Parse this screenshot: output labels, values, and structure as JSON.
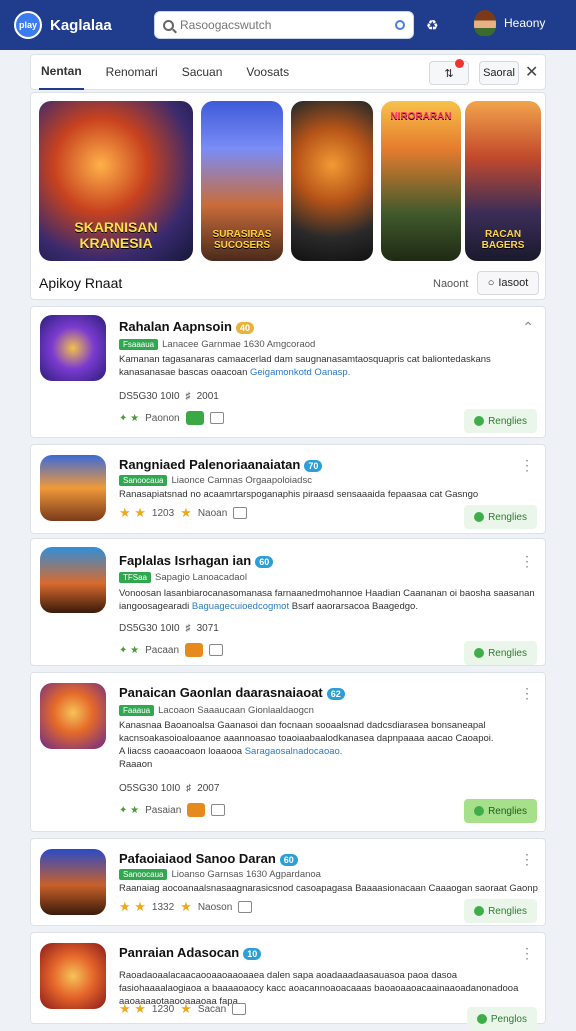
{
  "header": {
    "logo": "play",
    "title": "Kaglalaa",
    "search_placeholder": "Rasoogacswutch",
    "user_name": "Heaony"
  },
  "tabs": [
    {
      "label": "Nentan",
      "active": true
    },
    {
      "label": "Renomari"
    },
    {
      "label": "Sacuan"
    },
    {
      "label": "Voosats"
    }
  ],
  "toolbar": {
    "filter_label": "⇅",
    "sort_label": "Saoral"
  },
  "banner": {
    "heroes": [
      {
        "title": "SKARNISAN KRANESIA"
      },
      {
        "title": "SURASIRAS SUCOSERS"
      },
      {
        "title": ""
      },
      {
        "title": "NIRORARAN"
      },
      {
        "title": "RACAN BAGERS"
      }
    ],
    "featured_label": "Apikoy Rnaat",
    "more_link": "Naoont",
    "view_button": "Iasoot"
  },
  "apps": [
    {
      "name": "Rahalan Aapnsoin",
      "verify": "40",
      "meta": "Lanacee Garnmae 1630 Amgcoraod",
      "desc": "Kamanan tagasanaras camaacerlad dam saugnanasamtaosquapris cat baliontedaskans kanasanasae bascas oaacoan",
      "desc_link": "Geigamonkotd Oanasp.",
      "stats": "DS5G30 10I0",
      "stats2": "2001",
      "bottom": "Paonon",
      "install": "Renglies"
    },
    {
      "name": "Rangniaed Palenoriaanaiatan",
      "verify": "70",
      "meta": "Liaonce Camnas Orgaapoloiadsc",
      "desc": "Ranasapiatsnad no acaamrtarspoganaphis piraasd sensaaaida fepaasaa cat Gasngo",
      "rating": "1203",
      "rating_label": "Naoan",
      "install": "Renglies"
    },
    {
      "name": "Faplalas Isrhagan ian",
      "verify": "60",
      "meta": "Sapagio Lanoacadaol",
      "desc": "Vonoosan lasanbiarocanasomanasa farnaanedmohannoe Haadian Caananan oi baosha saasanan iangoosagearadi",
      "desc_link": "Baguagecuioedcogmot",
      "desc_tail": "Bsarf aaorarsacoa Baagedgo.",
      "stats": "DS5G30 10I0",
      "stats2": "3071",
      "bottom": "Pacaan",
      "install": "Renglies"
    },
    {
      "name": "Panaican Gaonlan daarasnaiaoat",
      "verify": "62",
      "meta": "Lacoaon Saaaucaan Gionlaaldaogcn",
      "desc": "Kanasnaa Baoanoalsa Gaanasoi dan focnaan sooaalsnad dadcsdiarasea bonsaneapal kacnsoakasoioaloaanoe aaannoasao toaoiaabaalodkanasea dapnpaaaa aacao Caoapoi.",
      "desc_link": "Saragaosalnadocaoao.",
      "desc_tail": "A liacss caoaacoaon loaaooa",
      "desc_extra": "Raaaon",
      "stats": "O5SG30 10I0",
      "stats2": "2007",
      "bottom": "Pasaian",
      "install": "Renglies"
    },
    {
      "name": "Pafaoiaiaod Sanoo Daran",
      "verify": "60",
      "meta": "Lioanso Garnsas 1630 Agpardanoa",
      "desc": "Raanaiag aocoanaalsnasaagnarasicsnod casoapagasa Baaaasionacaan Caaaogan saoraat Gaonp",
      "rating": "1332",
      "rating_label": "Naoson",
      "install": "Renglies"
    },
    {
      "name": "Panraian Adasocan",
      "verify": "10",
      "meta": "",
      "desc": "Raoadaoaalacaacaooaaoaaoaaea dalen sapa aoadaaadaasauasoa paoa dasoa fasiohaaaalaogiaoa a baaaaoaocy kacc aoacannoaoacaaas baoaoaaoacaainaaoadanonadooa aaoaaaaotaaooaaaoaa fapa...",
      "rating": "1230",
      "rating_label": "Sacan",
      "install": "Penglos"
    }
  ],
  "colors": {
    "header": "#1f3d8c",
    "accent": "#3d7cf0",
    "install_bg": "#eaf6ea",
    "install_highlight": "#a7e08a"
  }
}
